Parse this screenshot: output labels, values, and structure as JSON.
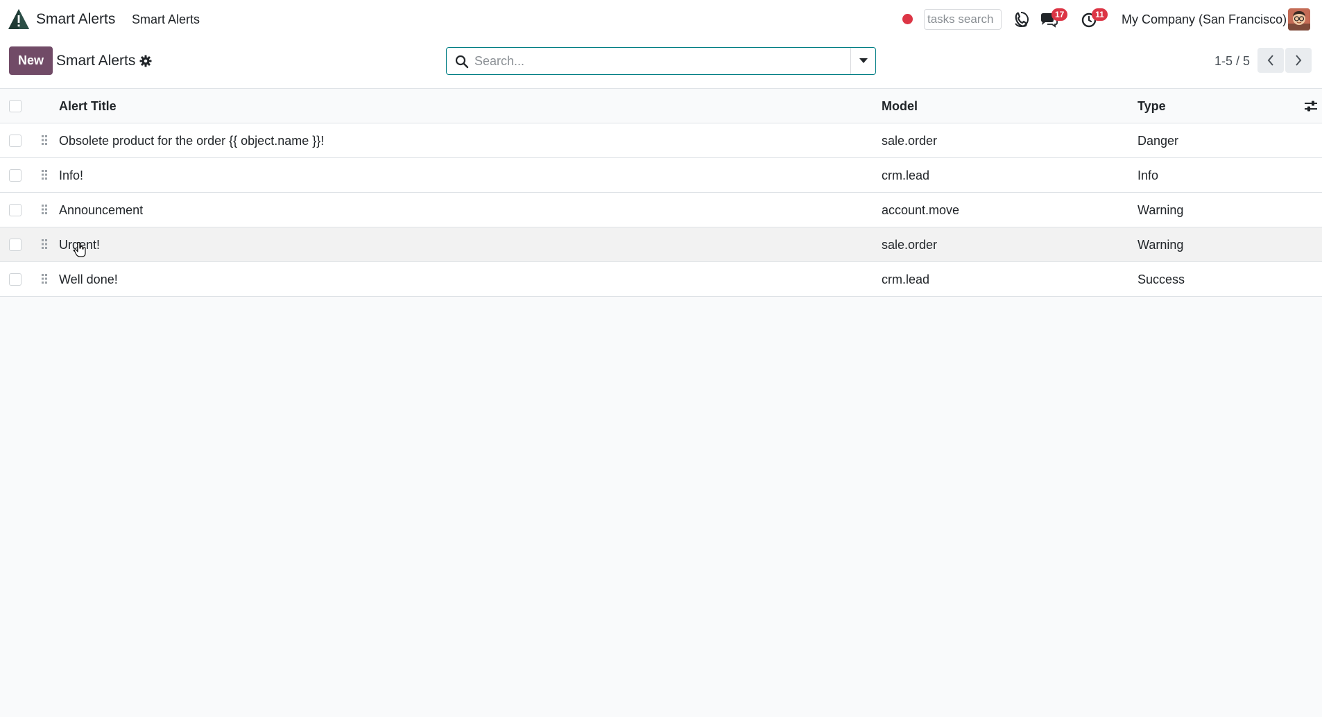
{
  "navbar": {
    "app_name": "Smart Alerts",
    "menu_item": "Smart Alerts",
    "tasks_search_placeholder": "tasks search",
    "messages_badge": "17",
    "activities_badge": "11",
    "company": "My Company (San Francisco)",
    "icons": [
      "app-logo-icon",
      "recording-dot-icon",
      "phone-icon",
      "chat-icon",
      "clock-icon",
      "avatar"
    ]
  },
  "control_panel": {
    "new_label": "New",
    "title": "Smart Alerts",
    "search_placeholder": "Search...",
    "pager": "1-5 / 5"
  },
  "table": {
    "headers": {
      "title": "Alert Title",
      "model": "Model",
      "type": "Type"
    },
    "rows": [
      {
        "title": "Obsolete product for the order {{ object.name }}!",
        "model": "sale.order",
        "type": "Danger"
      },
      {
        "title": "Info!",
        "model": "crm.lead",
        "type": "Info"
      },
      {
        "title": "Announcement",
        "model": "account.move",
        "type": "Warning"
      },
      {
        "title": "Urgent!",
        "model": "sale.order",
        "type": "Warning"
      },
      {
        "title": "Well done!",
        "model": "crm.lead",
        "type": "Success"
      }
    ]
  },
  "colors": {
    "primary": "#714b67",
    "search_border": "#017e84",
    "badge": "#dc3545"
  }
}
